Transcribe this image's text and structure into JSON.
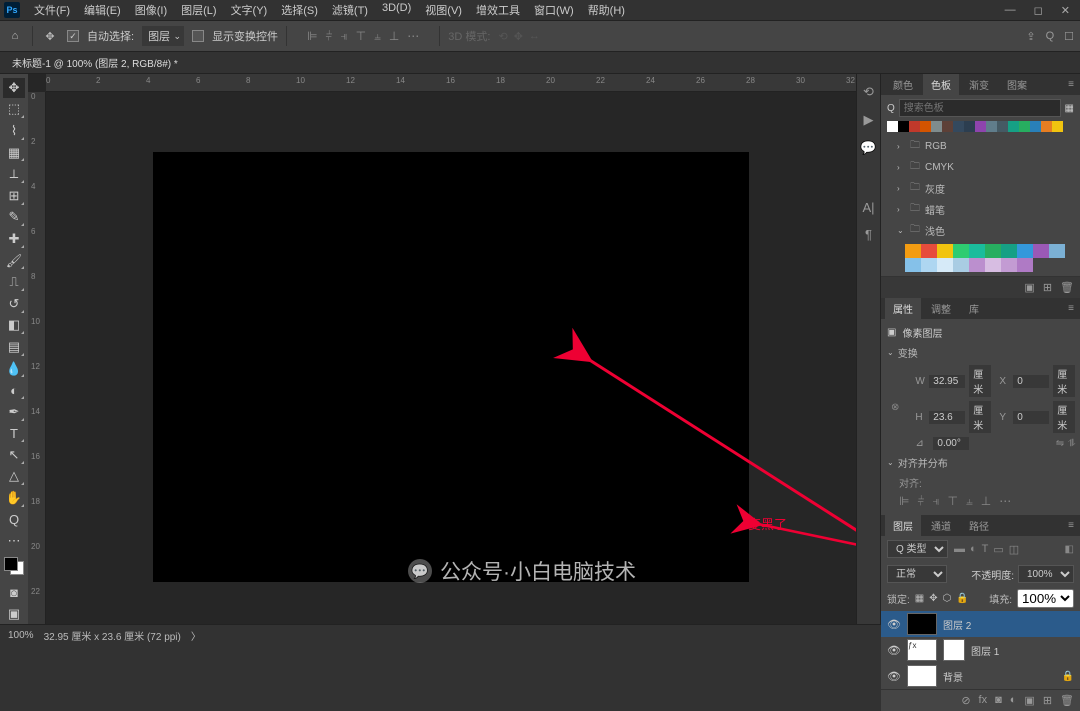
{
  "app": {
    "icon": "Ps"
  },
  "menubar": [
    "文件(F)",
    "编辑(E)",
    "图像(I)",
    "图层(L)",
    "文字(Y)",
    "选择(S)",
    "滤镜(T)",
    "3D(D)",
    "视图(V)",
    "增效工具",
    "窗口(W)",
    "帮助(H)"
  ],
  "optionsbar": {
    "auto_select_label": "自动选择:",
    "auto_select_value": "图层",
    "show_transform_label": "显示变换控件",
    "mode_label": "3D 模式:"
  },
  "document_tab": "未标题-1 @ 100% (图层 2, RGB/8#) *",
  "ruler_ticks": [
    "0",
    "2",
    "4",
    "6",
    "8",
    "10",
    "12",
    "14",
    "16",
    "18",
    "20",
    "22",
    "24",
    "26",
    "28",
    "30",
    "32"
  ],
  "ruler_v_ticks": [
    "0",
    "2",
    "4",
    "6",
    "8",
    "10",
    "12",
    "14",
    "16",
    "18",
    "20",
    "22"
  ],
  "swatches_panel": {
    "tabs": [
      "颜色",
      "色板",
      "渐变",
      "图案"
    ],
    "active_tab": 1,
    "search_placeholder": "搜索色板",
    "folders": [
      "RGB",
      "CMYK",
      "灰度",
      "蜡笔",
      "浅色"
    ],
    "open_folder": 4,
    "top_swatches": [
      "#ffffff",
      "#000000",
      "#c0392b",
      "#d35400",
      "#7f8c8d",
      "#5d4037",
      "#34495e",
      "#2c3e50",
      "#8e44ad",
      "#607d8b",
      "#455a64",
      "#16a085",
      "#27ae60",
      "#2980b9",
      "#e67e22",
      "#f1c40f"
    ],
    "light_swatches_row1": [
      "#f39c12",
      "#e74c3c",
      "#f1c40f",
      "#2ecc71",
      "#1abc9c",
      "#27ae60",
      "#16a085",
      "#3498db",
      "#9b59b6"
    ],
    "light_swatches_row2": [
      "#7bb0d4",
      "#85c1e9",
      "#aed6f1",
      "#d6eaf8",
      "#a9cce3",
      "#bb8fce",
      "#d7bde2",
      "#c39bd3",
      "#af7ac5"
    ]
  },
  "properties_panel": {
    "tabs": [
      "属性",
      "调整",
      "库"
    ],
    "type_label": "像素图层",
    "transform_label": "变换",
    "w_label": "W",
    "w_value": "32.95",
    "w_unit": "厘米",
    "h_label": "H",
    "h_value": "23.6",
    "h_unit": "厘米",
    "x_label": "X",
    "x_value": "0",
    "x_unit": "厘米",
    "y_label": "Y",
    "y_value": "0",
    "y_unit": "厘米",
    "angle_label": "⊿",
    "angle_value": "0.00°",
    "align_label": "对齐并分布",
    "align_to_label": "对齐:"
  },
  "layers_panel": {
    "tabs": [
      "图层",
      "通道",
      "路径"
    ],
    "kind_label": "Q 类型",
    "blend_mode": "正常",
    "opacity_label": "不透明度:",
    "opacity_value": "100%",
    "lock_label": "锁定:",
    "fill_label": "填充:",
    "fill_value": "100%",
    "layers": [
      {
        "name": "图层 2",
        "selected": true,
        "visible": true,
        "thumb": "black"
      },
      {
        "name": "图层 1",
        "selected": false,
        "visible": true,
        "thumb": "fx",
        "has_mask": true
      },
      {
        "name": "背景",
        "selected": false,
        "visible": true,
        "thumb": "white",
        "locked": true
      }
    ]
  },
  "statusbar": {
    "zoom": "100%",
    "docinfo": "32.95 厘米 x 23.6 厘米 (72 ppi)"
  },
  "annotation": {
    "text": "变黑了"
  },
  "watermark": {
    "text": "公众号·小白电脑技术"
  }
}
